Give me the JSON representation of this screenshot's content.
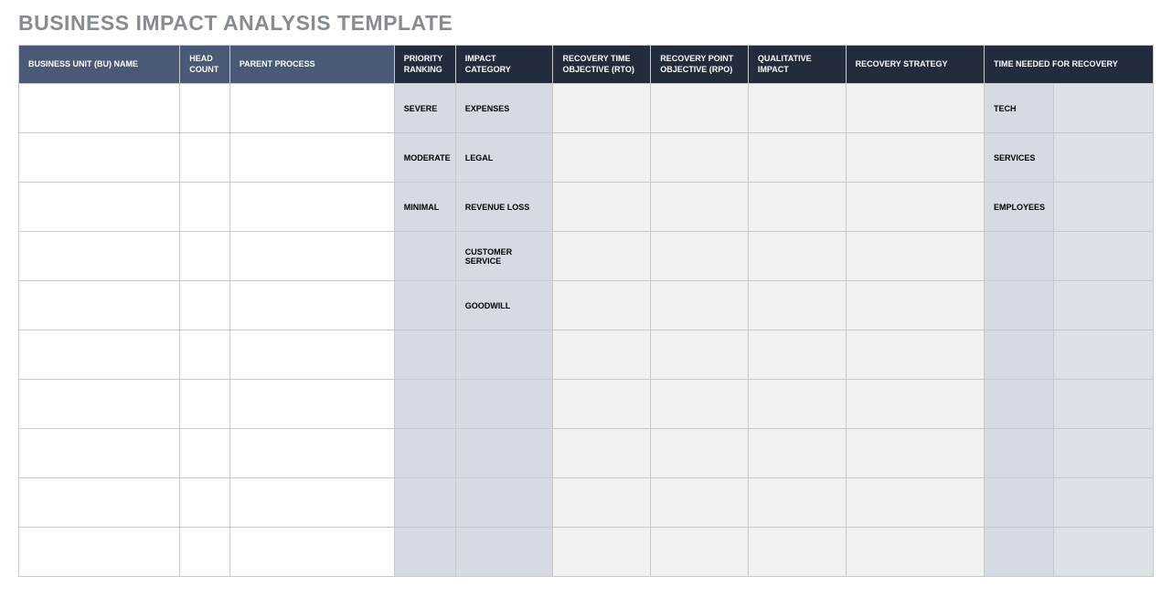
{
  "title": "BUSINESS IMPACT ANALYSIS TEMPLATE",
  "headers": {
    "bu_name": "BUSINESS UNIT (BU) NAME",
    "head_count": "HEAD COUNT",
    "parent_process": "PARENT PROCESS",
    "priority_ranking": "PRIORITY RANKING",
    "impact_category": "IMPACT CATEGORY",
    "rto": "RECOVERY TIME OBJECTIVE (RTO)",
    "rpo": "RECOVERY POINT OBJECTIVE (RPO)",
    "qualitative_impact": "QUALITATIVE IMPACT",
    "recovery_strategy": "RECOVERY STRATEGY",
    "time_needed": "TIME NEEDED FOR RECOVERY"
  },
  "rows": [
    {
      "priority": "SEVERE",
      "impact": "EXPENSES",
      "time": "TECH"
    },
    {
      "priority": "MODERATE",
      "impact": "LEGAL",
      "time": "SERVICES"
    },
    {
      "priority": "MINIMAL",
      "impact": "REVENUE LOSS",
      "time": "EMPLOYEES"
    },
    {
      "priority": "",
      "impact": "CUSTOMER SERVICE",
      "time": ""
    },
    {
      "priority": "",
      "impact": "GOODWILL",
      "time": ""
    },
    {
      "priority": "",
      "impact": "",
      "time": ""
    },
    {
      "priority": "",
      "impact": "",
      "time": ""
    },
    {
      "priority": "",
      "impact": "",
      "time": ""
    },
    {
      "priority": "",
      "impact": "",
      "time": ""
    },
    {
      "priority": "",
      "impact": "",
      "time": ""
    }
  ]
}
